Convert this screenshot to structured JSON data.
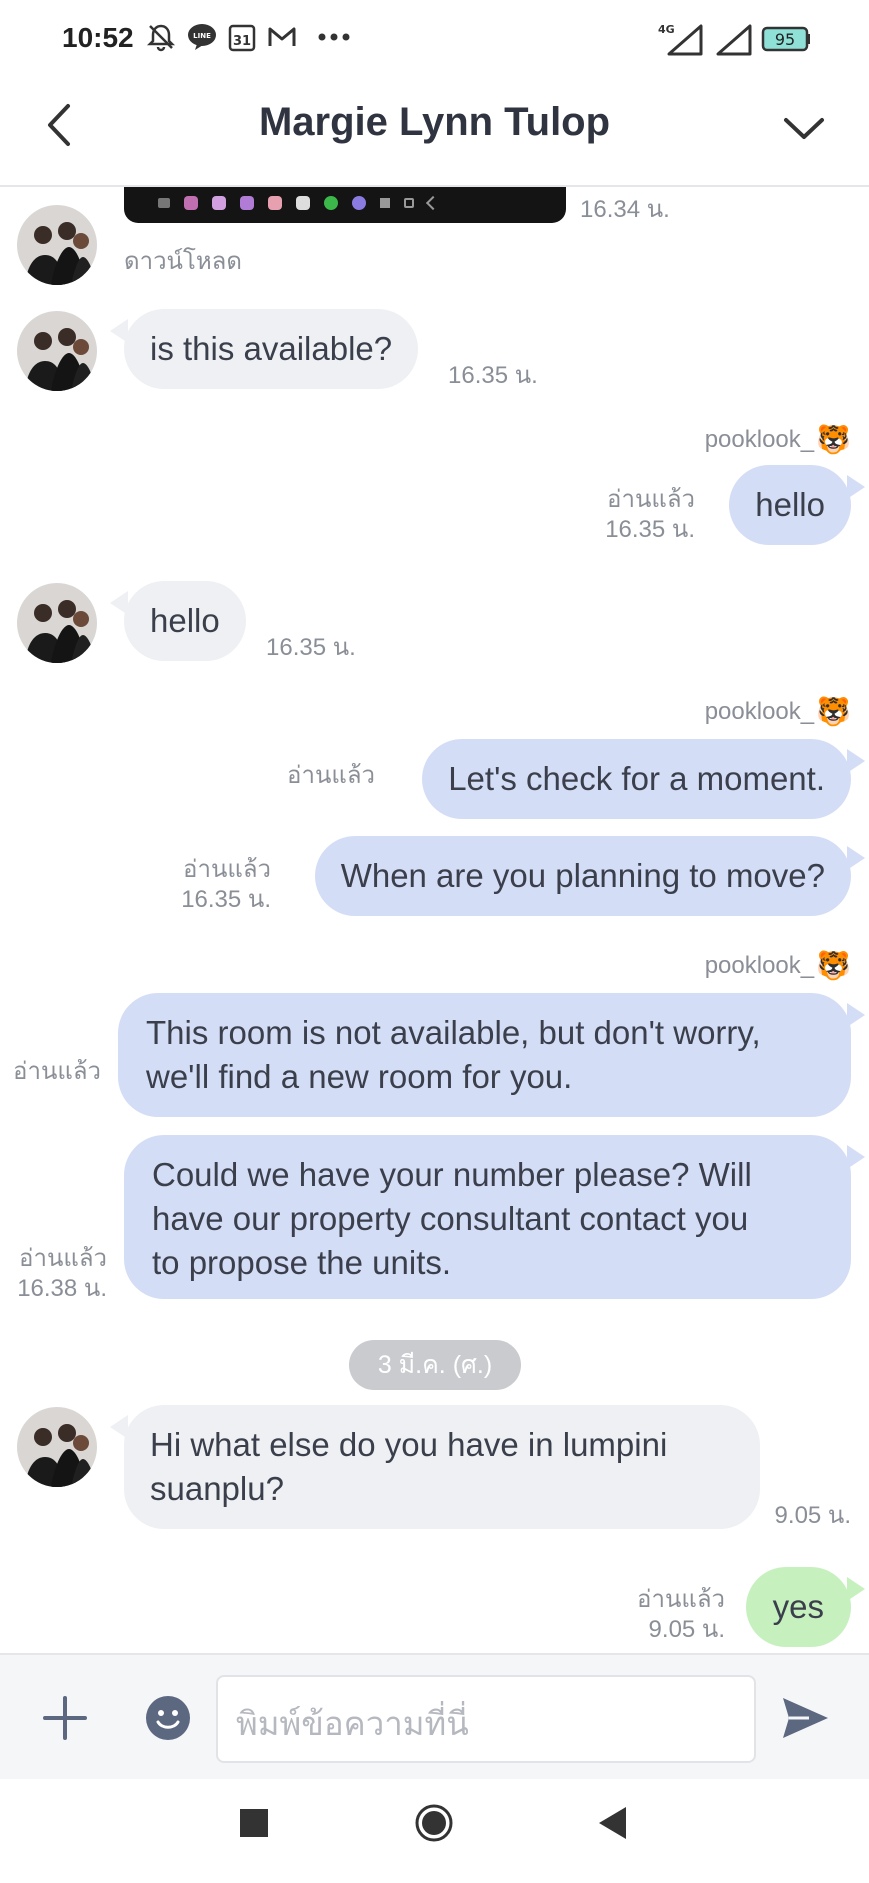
{
  "status_bar": {
    "time": "10:52",
    "icons": [
      "bell-off-icon",
      "line-app-icon",
      "calendar-31-icon",
      "gmail-icon",
      "more-dots-icon"
    ],
    "calendar_day": "31",
    "network": "4G",
    "battery": "95"
  },
  "header": {
    "title": "Margie Lynn Tulop"
  },
  "messages": [
    {
      "type": "image",
      "direction": "in",
      "time": "16.34 น.",
      "download_label": "ดาวน์โหลด"
    },
    {
      "type": "text",
      "direction": "in",
      "text": "is this available?",
      "time": "16.35 น."
    },
    {
      "type": "text",
      "direction": "out",
      "sender": "pooklook_",
      "read": "อ่านแล้ว",
      "time": "16.35 น.",
      "text": "hello"
    },
    {
      "type": "text",
      "direction": "in",
      "text": "hello",
      "time": "16.35 น."
    },
    {
      "type": "text",
      "direction": "out",
      "sender": "pooklook_",
      "read": "อ่านแล้ว",
      "text": "Let's check for a moment."
    },
    {
      "type": "text",
      "direction": "out",
      "read": "อ่านแล้ว",
      "time": "16.35 น.",
      "text": "When are you planning to move?"
    },
    {
      "type": "text",
      "direction": "out",
      "sender": "pooklook_",
      "read": "อ่านแล้ว",
      "lines": [
        "This room is not available, but don't worry,",
        "we'll find a new room for you."
      ]
    },
    {
      "type": "text",
      "direction": "out",
      "read": "อ่านแล้ว",
      "time": "16.38 น.",
      "lines": [
        "Could we have your number please? Will",
        "have our property consultant contact you",
        "to propose the units."
      ]
    },
    {
      "type": "date",
      "label": "3 มี.ค. (ศ.)"
    },
    {
      "type": "text",
      "direction": "in",
      "lines": [
        "Hi what else do you have in lumpini",
        "suanplu?"
      ],
      "time": "9.05 น."
    },
    {
      "type": "text",
      "direction": "out",
      "read": "อ่านแล้ว",
      "time": "9.05 น.",
      "text": "yes"
    }
  ],
  "input": {
    "placeholder": "พิมพ์ข้อความที่นี่"
  },
  "colors": {
    "outgoing_bubble": "#d4ddf6",
    "incoming_bubble": "#eef0f3",
    "latest_outgoing_bubble": "#c7f0bf",
    "send_icon": "#5c6780"
  }
}
